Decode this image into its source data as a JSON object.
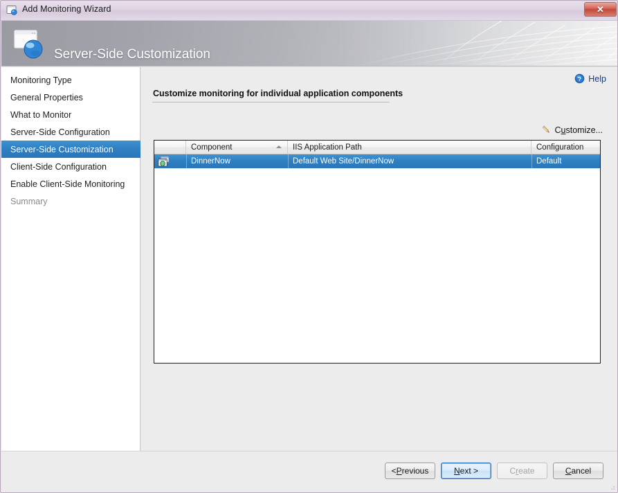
{
  "window": {
    "title": "Add Monitoring Wizard",
    "title_icon": "wizard-window-sphere-icon",
    "close_label": "✕"
  },
  "banner": {
    "title": "Server-Side Customization",
    "icon": "wizard-window-sphere-icon"
  },
  "sidebar": {
    "items": [
      {
        "label": "Monitoring Type",
        "state": "normal"
      },
      {
        "label": "General Properties",
        "state": "normal"
      },
      {
        "label": "What to Monitor",
        "state": "normal"
      },
      {
        "label": "Server-Side Configuration",
        "state": "normal"
      },
      {
        "label": "Server-Side Customization",
        "state": "selected"
      },
      {
        "label": "Client-Side Configuration",
        "state": "normal"
      },
      {
        "label": "Enable Client-Side Monitoring",
        "state": "normal"
      },
      {
        "label": "Summary",
        "state": "disabled"
      }
    ]
  },
  "main": {
    "help_label": "Help",
    "help_icon": "help-question-icon",
    "section_title": "Customize monitoring for individual application components",
    "customize_label_pre": "C",
    "customize_label_accel": "u",
    "customize_label_post": "stomize...",
    "customize_icon": "pencil-icon"
  },
  "grid": {
    "columns": [
      {
        "label": "",
        "key": "icon"
      },
      {
        "label": "Component",
        "key": "component",
        "sorted": "ascending"
      },
      {
        "label": "IIS Application Path",
        "key": "path"
      },
      {
        "label": "Configuration",
        "key": "configuration"
      }
    ],
    "rows": [
      {
        "icon": "web-application-icon",
        "component": "DinnerNow",
        "path": "Default Web Site/DinnerNow",
        "configuration": "Default",
        "selected": true
      }
    ]
  },
  "footer": {
    "buttons": [
      {
        "name": "previous",
        "pre": "< ",
        "accel": "P",
        "post": "revious",
        "state": "normal"
      },
      {
        "name": "next",
        "pre": "",
        "accel": "N",
        "post": "ext >",
        "state": "focused"
      },
      {
        "name": "create",
        "pre": "C",
        "accel": "r",
        "post": "eate",
        "state": "disabled"
      },
      {
        "name": "cancel",
        "pre": "",
        "accel": "C",
        "post": "ancel",
        "state": "normal"
      }
    ]
  },
  "colors": {
    "selection_blue": "#2f7fc2",
    "link_blue": "#133a8c",
    "titlebar": "#ded3e3",
    "close_red": "#c4493c",
    "panel_gray": "#ececec"
  }
}
